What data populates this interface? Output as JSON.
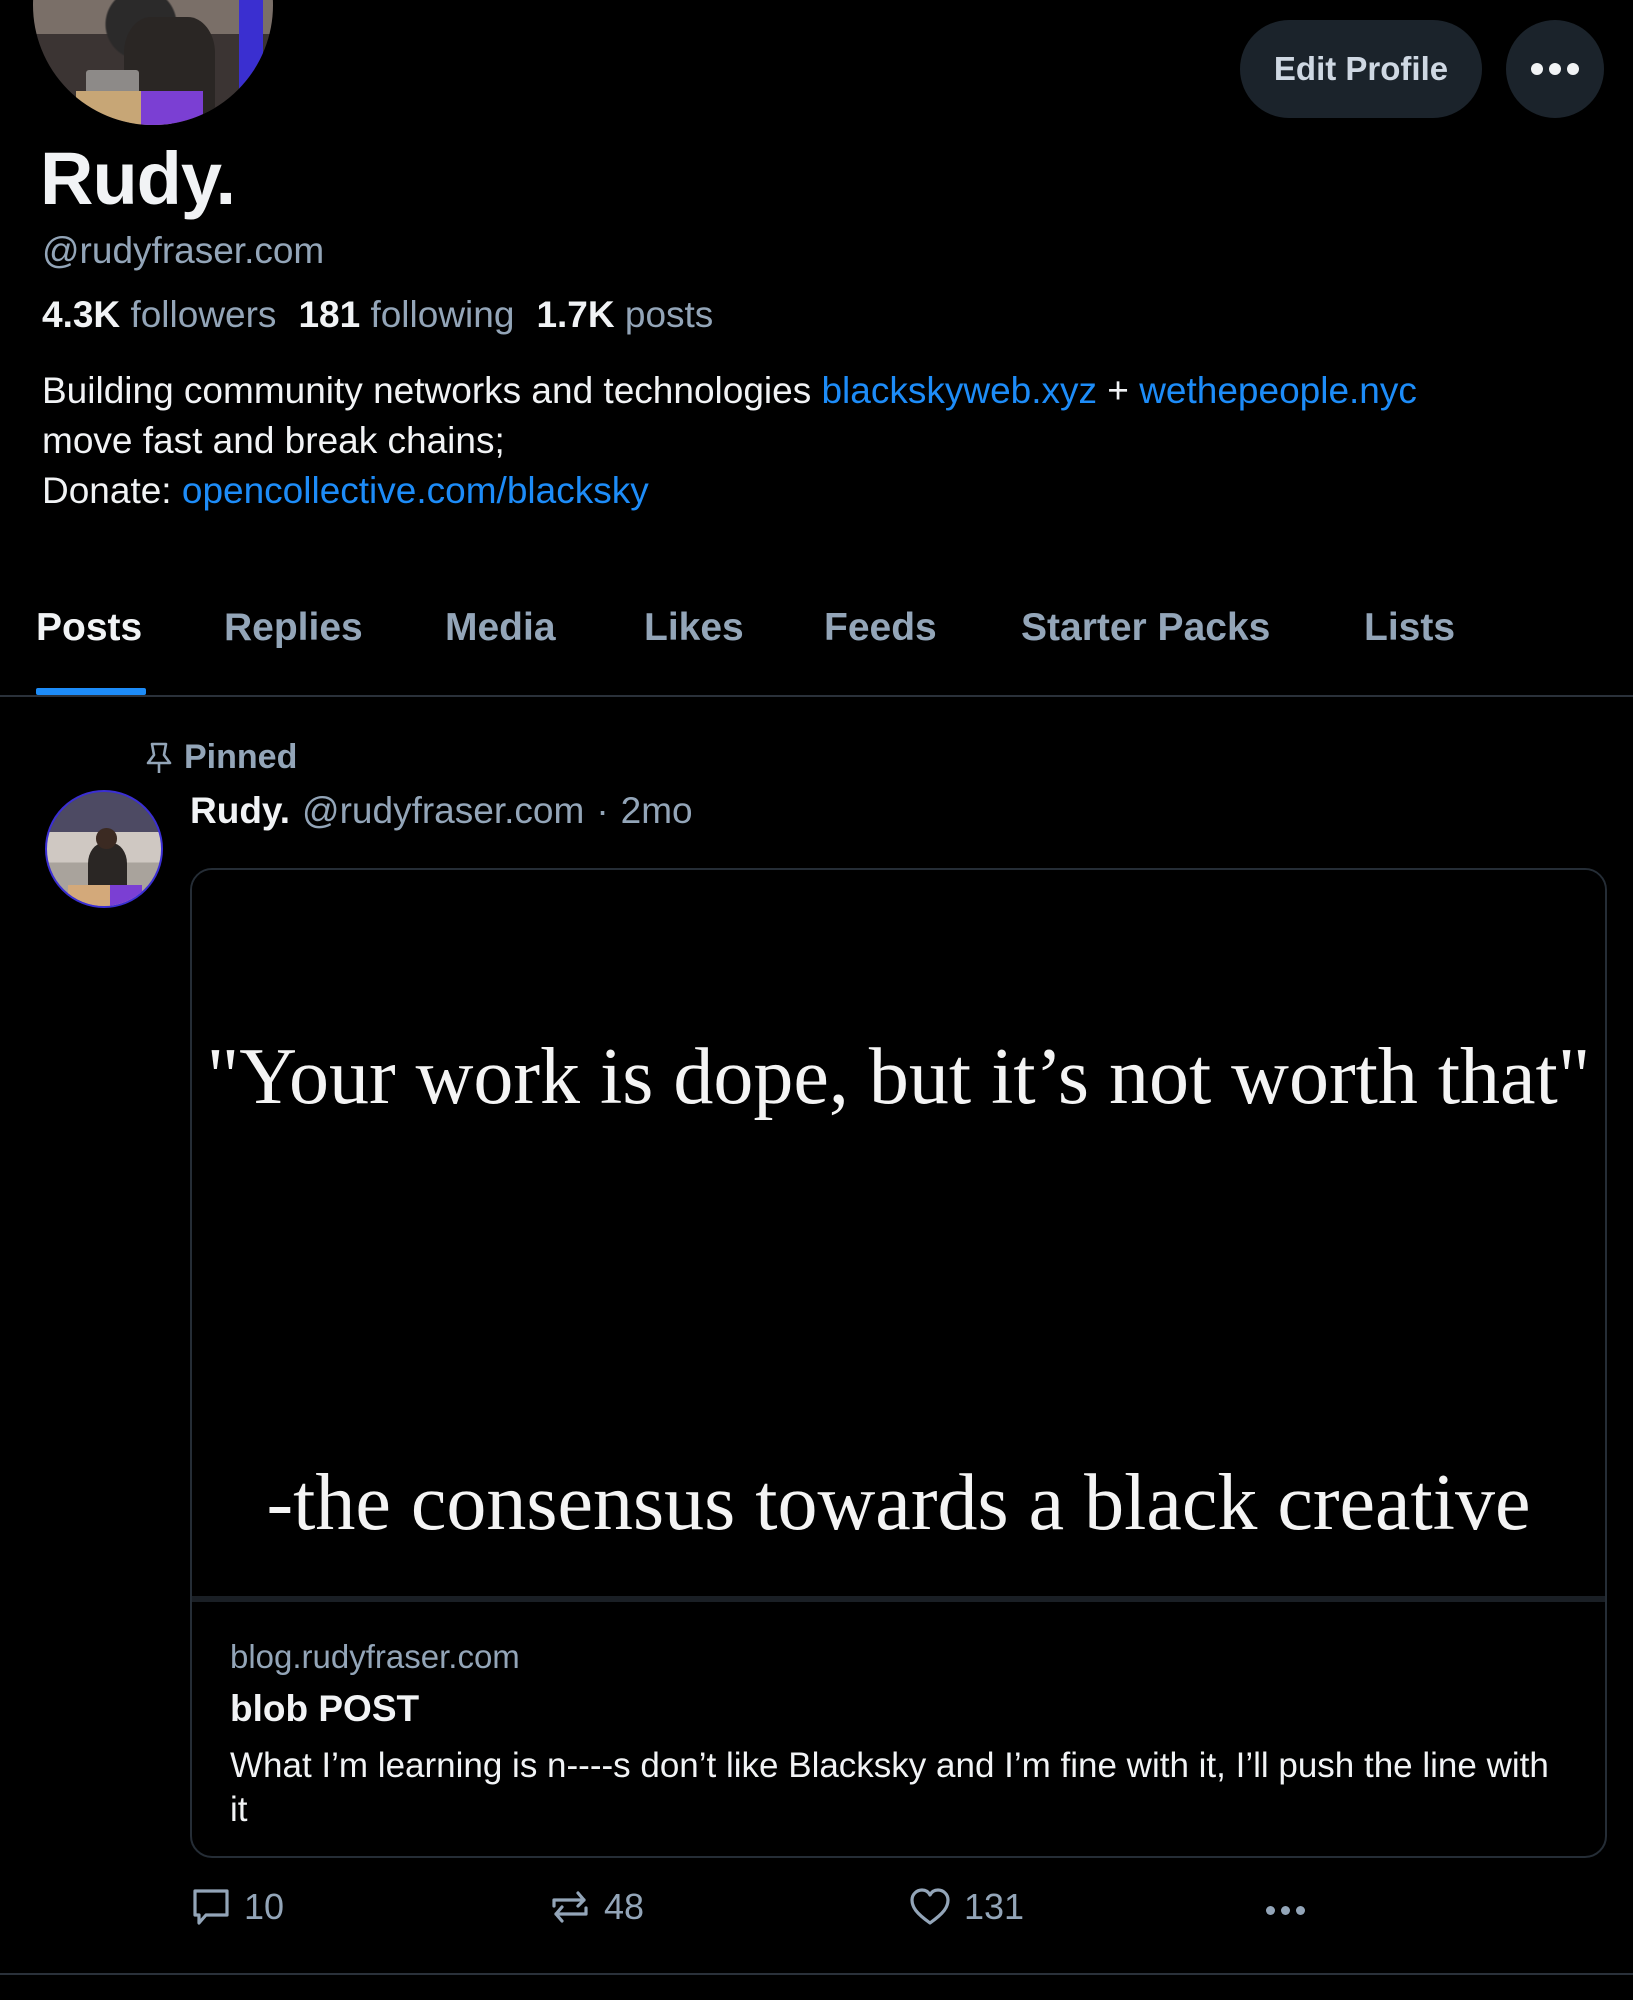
{
  "profile": {
    "display_name": "Rudy.",
    "handle": "@rudyfraser.com",
    "avatar_icon": "profile-photo",
    "stats": [
      {
        "value": "4.3K",
        "label": "followers"
      },
      {
        "value": "181",
        "label": "following"
      },
      {
        "value": "1.7K",
        "label": "posts"
      }
    ],
    "bio": {
      "line1_text": "Building community networks and technologies",
      "link1": "blackskyweb.xyz",
      "plus": "+",
      "link2": "wethepeople.nyc",
      "line2": "move fast and break chains;",
      "donate_label": "Donate:",
      "donate_link": "opencollective.com/blacksky"
    }
  },
  "actions": {
    "edit_profile_label": "Edit Profile",
    "more_icon": "ellipsis-icon"
  },
  "tabs": [
    {
      "label": "Posts",
      "active": true
    },
    {
      "label": "Replies",
      "active": false
    },
    {
      "label": "Media",
      "active": false
    },
    {
      "label": "Likes",
      "active": false
    },
    {
      "label": "Feeds",
      "active": false
    },
    {
      "label": "Starter Packs",
      "active": false
    },
    {
      "label": "Lists",
      "active": false
    }
  ],
  "post": {
    "pinned_label": "Pinned",
    "author": "Rudy.",
    "handle": "@rudyfraser.com",
    "separator": "·",
    "time": "2mo",
    "embed": {
      "image_quote": "\"Your work is dope, but it’s not worth that\"",
      "image_attribution": "-the consensus towards a black creative",
      "domain": "blog.rudyfraser.com",
      "title": "blob POST",
      "description": "What I’m learning is n----s don’t like Blacksky and I’m fine with it, I’ll push the line with it"
    },
    "counts": {
      "replies": "10",
      "reposts": "48",
      "likes": "131"
    }
  },
  "colors": {
    "background": "#000000",
    "accent": "#1d8cf8",
    "muted_text": "#93a5b8",
    "button_bg": "#1b232b",
    "divider": "#2a313a"
  }
}
